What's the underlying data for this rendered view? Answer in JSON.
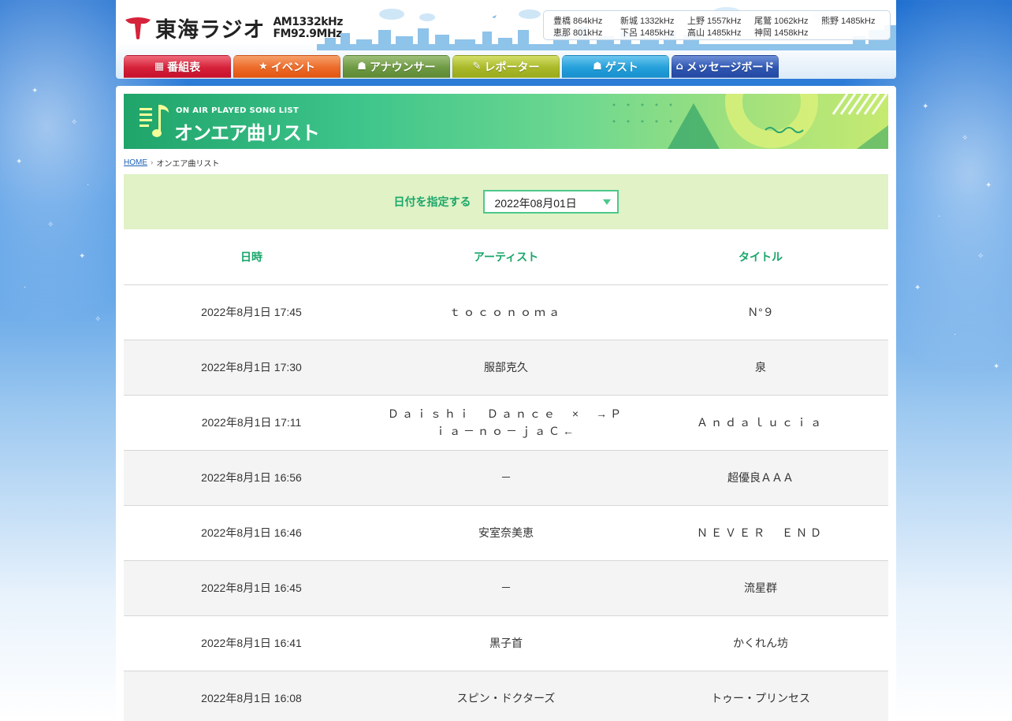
{
  "header": {
    "logo_name": "東海ラジオ",
    "logo_am": "AM1332kHz",
    "logo_fm": "FM92.9MHz",
    "frequencies_row1": [
      "豊橋 864kHz",
      "新城 1332kHz",
      "上野 1557kHz",
      "尾鷲 1062kHz",
      "熊野 1485kHz"
    ],
    "frequencies_row2": [
      "恵那 801kHz",
      "下呂 1485kHz",
      "高山 1485kHz",
      "神岡 1458kHz"
    ]
  },
  "nav": {
    "tabs": [
      {
        "label": "番組表",
        "icon": "grid-icon",
        "color": "#d6223a"
      },
      {
        "label": "イベント",
        "icon": "star-icon",
        "color": "#ec6b2a"
      },
      {
        "label": "アナウンサー",
        "icon": "person-icon",
        "color": "#6f9a44"
      },
      {
        "label": "レポーター",
        "icon": "microphone-icon",
        "color": "#aab92a"
      },
      {
        "label": "ゲスト",
        "icon": "person-icon",
        "color": "#25a0db"
      },
      {
        "label": "メッセージボード",
        "icon": "mailbox-icon",
        "color": "#2f57b3"
      }
    ]
  },
  "banner": {
    "subtitle": "ON AIR PLAYED SONG LIST",
    "title": "オンエア曲リスト"
  },
  "breadcrumb": {
    "home": "HOME",
    "current": "オンエア曲リスト"
  },
  "filter": {
    "label": "日付を指定する",
    "selected_date": "2022年08月01日"
  },
  "table": {
    "headers": [
      "日時",
      "アーティスト",
      "タイトル"
    ],
    "rows": [
      {
        "datetime": "2022年8月1日 17:45",
        "artist": "ｔｏｃｏｎｏｍａ",
        "title": "Ｎ°９"
      },
      {
        "datetime": "2022年8月1日 17:30",
        "artist": "服部克久",
        "title": "泉"
      },
      {
        "datetime": "2022年8月1日 17:11",
        "artist": "Ｄａｉｓｈｉ　Ｄａｎｃｅ　×　→Ｐｉａ－ｎｏ－ｊａＣ←",
        "title": "Ａｎｄａｌｕｃｉａ"
      },
      {
        "datetime": "2022年8月1日 16:56",
        "artist": "－",
        "title": "超優良ＡＡＡ"
      },
      {
        "datetime": "2022年8月1日 16:46",
        "artist": "安室奈美恵",
        "title": "ＮＥＶＥＲ　ＥＮＤ"
      },
      {
        "datetime": "2022年8月1日 16:45",
        "artist": "－",
        "title": "流星群"
      },
      {
        "datetime": "2022年8月1日 16:41",
        "artist": "黒子首",
        "title": "かくれん坊"
      },
      {
        "datetime": "2022年8月1日 16:08",
        "artist": "スピン・ドクターズ",
        "title": "トゥー・プリンセス"
      }
    ]
  }
}
